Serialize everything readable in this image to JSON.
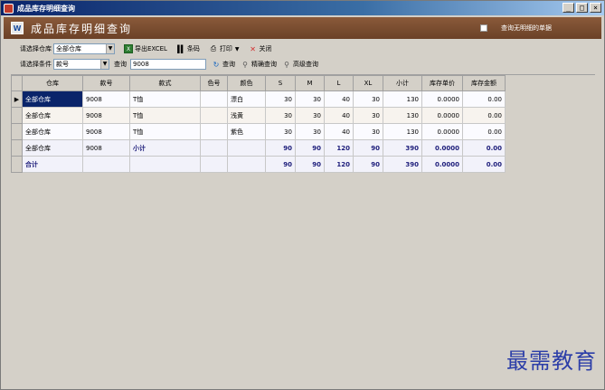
{
  "window": {
    "title": "成品库存明细查询"
  },
  "banner": {
    "heading": "成品库存明细查询",
    "logo_text": "W",
    "checkbox_label": "查询无明细的单据"
  },
  "toolbar": {
    "warehouse_label": "请选择仓库",
    "warehouse_value": "全部仓库",
    "export_label": "导出EXCEL",
    "barcode_label": "条码",
    "print_label": "打印",
    "close_label": "关闭",
    "condition_label": "请选择条件",
    "condition_value": "款号",
    "query_label": "查询",
    "query_value": "9008",
    "search_label": "查询",
    "exact_label": "精确查询",
    "advanced_label": "高级查询"
  },
  "table": {
    "headers": [
      "仓库",
      "款号",
      "款式",
      "色号",
      "颜色",
      "S",
      "M",
      "L",
      "XL",
      "小计",
      "库存单价",
      "库存金额"
    ],
    "rows": [
      [
        "全部仓库",
        "9008",
        "T恤",
        "",
        "漂白",
        "30",
        "30",
        "40",
        "30",
        "130",
        "0.0000",
        "0.00"
      ],
      [
        "全部仓库",
        "9008",
        "T恤",
        "",
        "浅黄",
        "30",
        "30",
        "40",
        "30",
        "130",
        "0.0000",
        "0.00"
      ],
      [
        "全部仓库",
        "9008",
        "T恤",
        "",
        "紫色",
        "30",
        "30",
        "40",
        "30",
        "130",
        "0.0000",
        "0.00"
      ],
      [
        "全部仓库",
        "9008",
        "小计",
        "",
        "",
        "90",
        "90",
        "120",
        "90",
        "390",
        "0.0000",
        "0.00"
      ],
      [
        "合计",
        "",
        "",
        "",
        "",
        "90",
        "90",
        "120",
        "90",
        "390",
        "0.0000",
        "0.00"
      ]
    ]
  },
  "watermark": "最需教育",
  "colors": {
    "banner": "#6b4127",
    "titlebar": "#0a246a",
    "selection": "#0a246a",
    "total_text": "#1c1c7a"
  }
}
